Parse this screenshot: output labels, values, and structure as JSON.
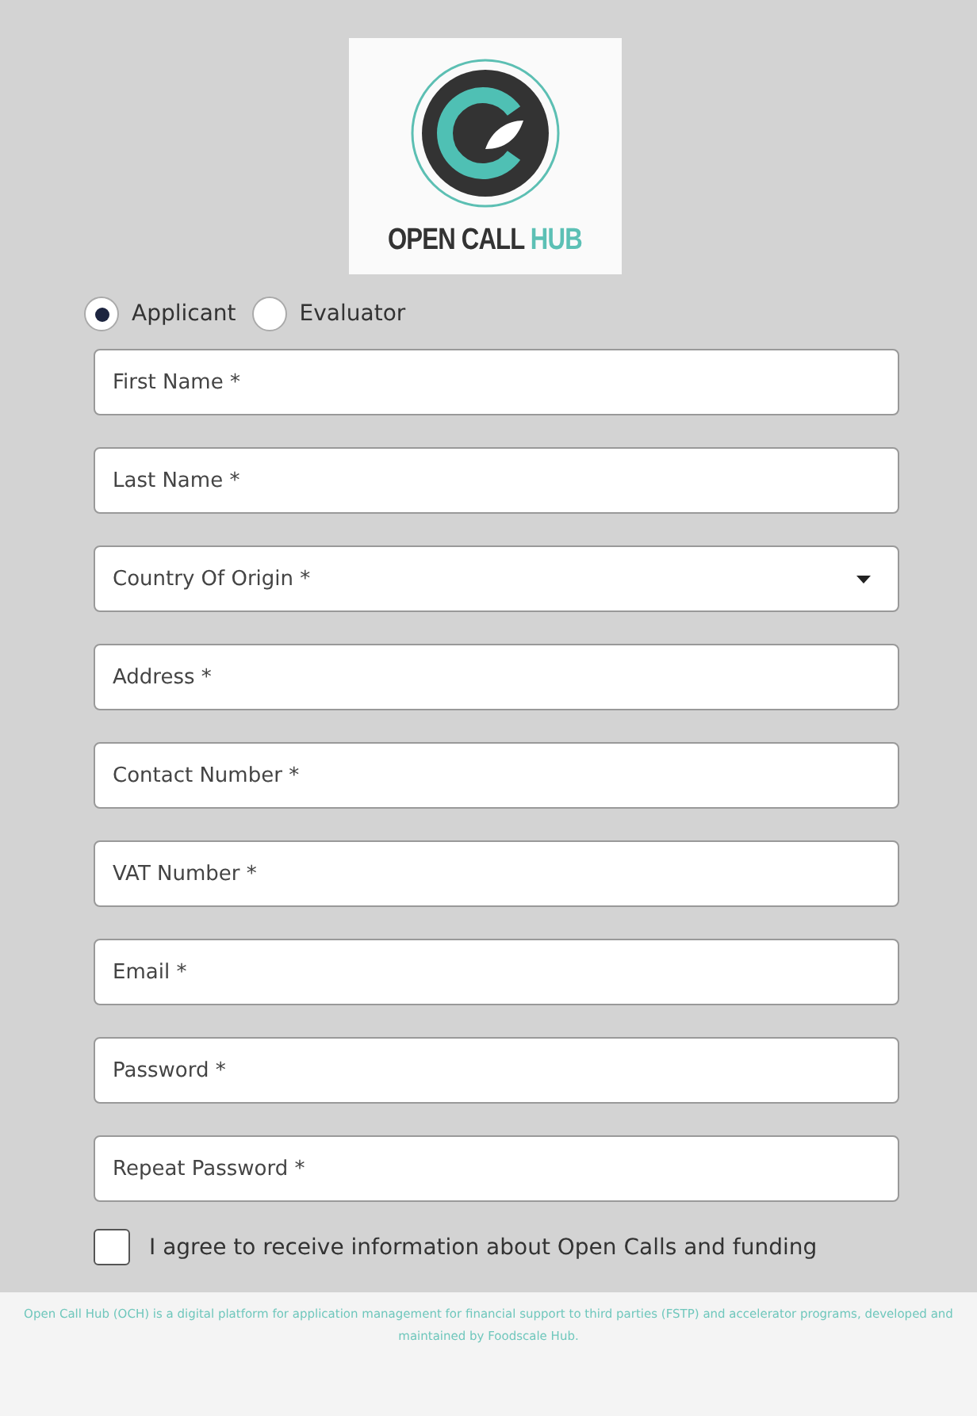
{
  "logo": {
    "text": "OPEN CALL",
    "accent": "HUB"
  },
  "roles": [
    {
      "label": "Applicant",
      "selected": true
    },
    {
      "label": "Evaluator",
      "selected": false
    }
  ],
  "fields": [
    {
      "kind": "text",
      "placeholder": "First Name *"
    },
    {
      "kind": "text",
      "placeholder": "Last Name *"
    },
    {
      "kind": "select",
      "placeholder": "Country Of Origin *"
    },
    {
      "kind": "text",
      "placeholder": "Address *"
    },
    {
      "kind": "text",
      "placeholder": "Contact Number *"
    },
    {
      "kind": "text",
      "placeholder": "VAT Number *"
    },
    {
      "kind": "text",
      "placeholder": "Email *"
    },
    {
      "kind": "password",
      "placeholder": "Password *"
    },
    {
      "kind": "password",
      "placeholder": "Repeat Password *"
    }
  ],
  "consent": {
    "label": "I agree to receive information about Open Calls and funding",
    "checked": false
  },
  "footer": "Open Call Hub (OCH) is a digital platform for application management for financial support to third parties (FSTP) and accelerator programs, developed and maintained by Foodscale Hub."
}
